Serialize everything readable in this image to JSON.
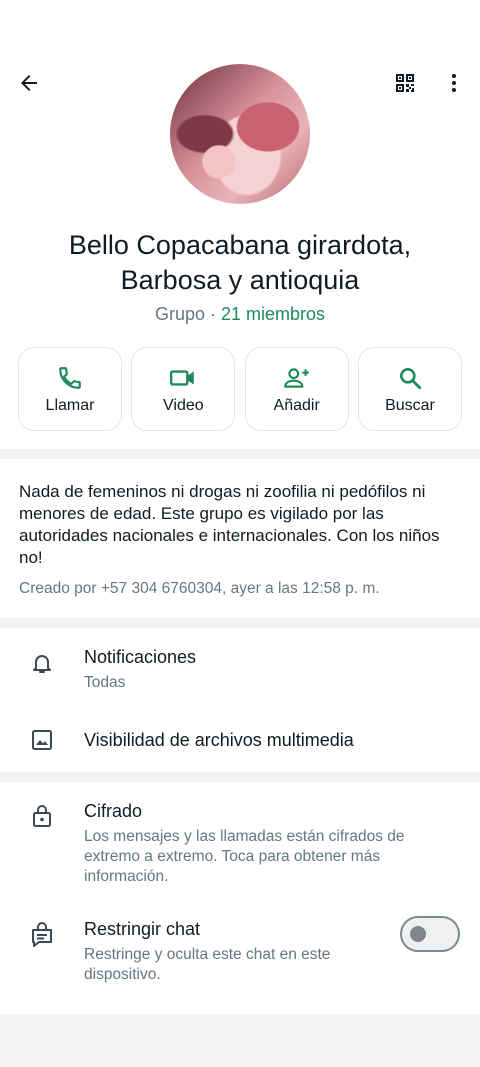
{
  "group": {
    "name_line1": "Bello Copacabana girardota,",
    "name_line2": "Barbosa y antioquia",
    "type_label": "Grupo · ",
    "members_label": "21 miembros"
  },
  "actions": [
    {
      "label": "Llamar",
      "icon": "phone-icon"
    },
    {
      "label": "Video",
      "icon": "video-icon"
    },
    {
      "label": "Añadir",
      "icon": "add-person-icon"
    },
    {
      "label": "Buscar",
      "icon": "search-icon"
    }
  ],
  "description": {
    "text": "Nada de femeninos ni drogas ni zoofilia ni pedófilos ni menores de edad. Este grupo es vigilado por las autoridades nacionales e internacionales. Con los niños no!",
    "created": "Creado por +57 304 6760304, ayer a las 12:58 p. m."
  },
  "settings": {
    "notifications_label": "Notificaciones",
    "notifications_value": "Todas",
    "media_visibility_label": "Visibilidad de archivos multimedia"
  },
  "security": {
    "encryption_label": "Cifrado",
    "encryption_desc": "Los mensajes y las llamadas están cifrados de extremo a extremo. Toca para obtener más información.",
    "restrict_label": "Restringir chat",
    "restrict_desc": "Restringe y oculta este chat en este dispositivo.",
    "restrict_enabled": false
  },
  "colors": {
    "accent_green": "#1f8a5b",
    "icon_dark": "#3b4a54",
    "secondary_text": "#667781"
  }
}
